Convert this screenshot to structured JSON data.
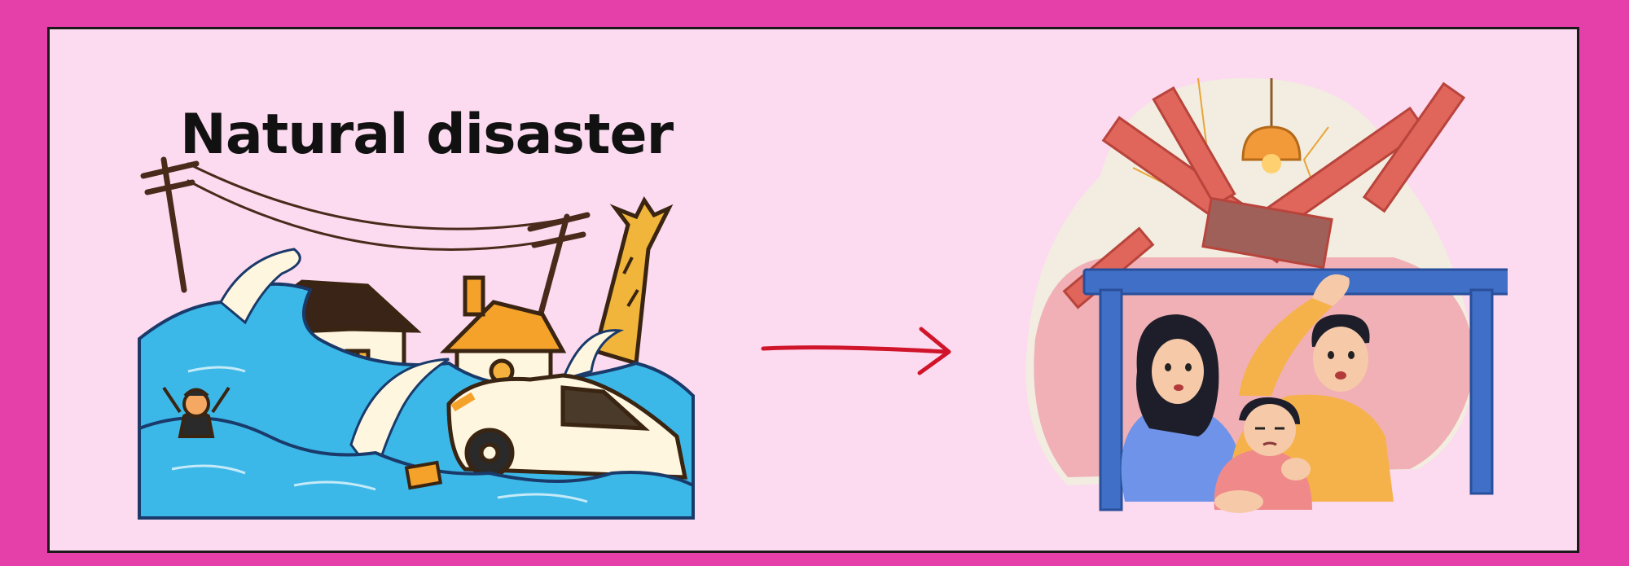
{
  "title": "Natural disaster",
  "colors": {
    "outer_border": "#e540a9",
    "panel_background": "#fcdaf0",
    "water": "#3bb8e8",
    "arrow": "#d0142a",
    "table": "#3f6fc7"
  },
  "illustrations": {
    "left": "flood-scene",
    "center": "arrow-right",
    "right": "family-sheltering-under-table"
  }
}
